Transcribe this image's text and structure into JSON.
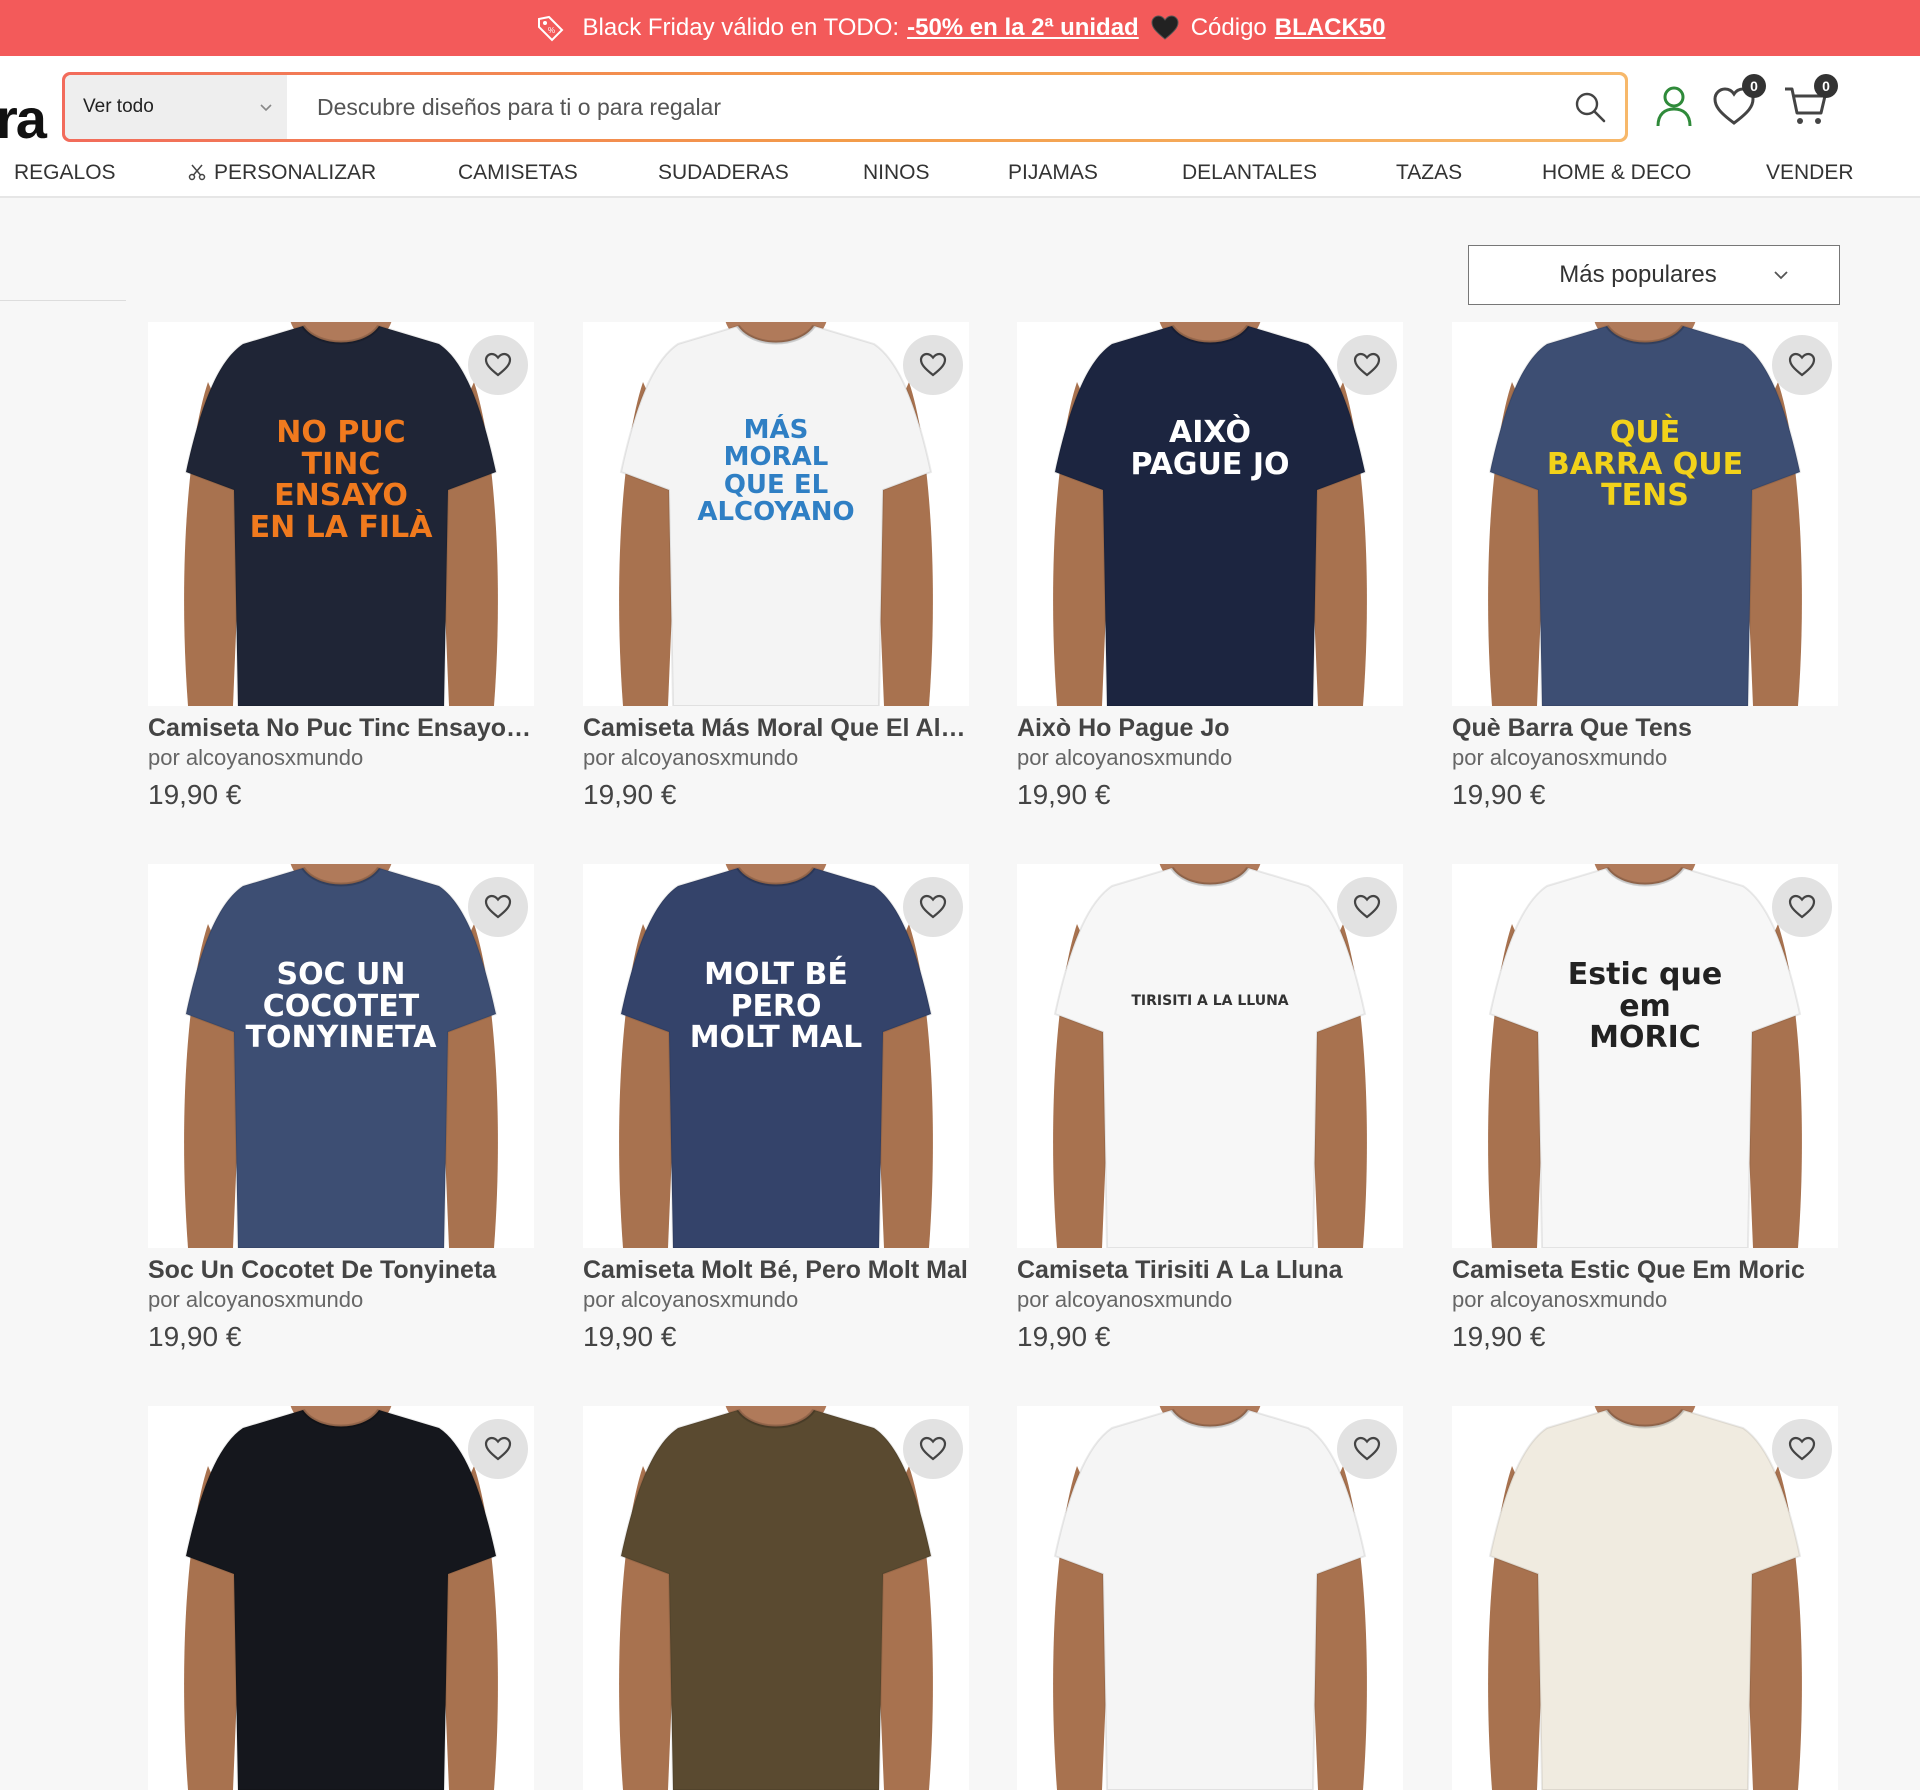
{
  "promo": {
    "text_before": "Black Friday válido en TODO:",
    "discount": "-50% en la 2ª unidad",
    "code_label": "Código",
    "code": "BLACK50"
  },
  "header": {
    "logo_fragment": "ra",
    "category_select": "Ver todo",
    "search_placeholder": "Descubre diseños para ti o para regalar",
    "wishlist_count": "0",
    "cart_count": "0"
  },
  "nav": [
    "REGALOS",
    "PERSONALIZAR",
    "CAMISETAS",
    "SUDADERAS",
    "NINOS",
    "PIJAMAS",
    "DELANTALES",
    "TAZAS",
    "HOME & DECO",
    "VENDER"
  ],
  "sort": {
    "selected": "Más populares"
  },
  "products": [
    {
      "title": "Camiseta No Puc Tinc Ensayo E...",
      "seller": "por alcoyanosxmundo",
      "price": "19,90 €",
      "shirt_color": "#1f2536",
      "design": [
        "NO PUC",
        "TINC ENSAYO",
        "EN LA FILÀ"
      ],
      "design_color": "#f07a1e"
    },
    {
      "title": "Camiseta Más Moral Que El Alc...",
      "seller": "por alcoyanosxmundo",
      "price": "19,90 €",
      "shirt_color": "#f4f4f4",
      "design": [
        "MÁS",
        "MORAL",
        "QUE EL",
        "ALCOYANO"
      ],
      "design_color": "#2f7fc4"
    },
    {
      "title": "Això Ho Pague Jo",
      "seller": "por alcoyanosxmundo",
      "price": "19,90 €",
      "shirt_color": "#1c2540",
      "design": [
        "AIXÒ",
        "PAGUE JO"
      ],
      "design_color": "#ffffff"
    },
    {
      "title": "Què Barra Que Tens",
      "seller": "por alcoyanosxmundo",
      "price": "19,90 €",
      "shirt_color": "#3d4e73",
      "design": [
        "QUÈ",
        "BARRA QUE",
        "TENS"
      ],
      "design_color": "#f2d21a"
    },
    {
      "title": "Soc Un Cocotet De Tonyineta",
      "seller": "por alcoyanosxmundo",
      "price": "19,90 €",
      "shirt_color": "#3d4e73",
      "design": [
        "SOC UN",
        "COCOTET",
        "TONYINETA"
      ],
      "design_color": "#ffffff"
    },
    {
      "title": "Camiseta Molt Bé, Pero Molt Mal",
      "seller": "por alcoyanosxmundo",
      "price": "19,90 €",
      "shirt_color": "#34436a",
      "design": [
        "MOLT BÉ",
        "PERO",
        "MOLT MAL"
      ],
      "design_color": "#ffffff"
    },
    {
      "title": "Camiseta Tirisiti A La Lluna",
      "seller": "por alcoyanosxmundo",
      "price": "19,90 €",
      "shirt_color": "#f7f7f7",
      "design": [
        "TIRISITI A LA LLUNA"
      ],
      "design_color": "#333333"
    },
    {
      "title": "Camiseta Estic Que Em Moric",
      "seller": "por alcoyanosxmundo",
      "price": "19,90 €",
      "shirt_color": "#f7f7f7",
      "design": [
        "Estic que em",
        "MORIC"
      ],
      "design_color": "#222222"
    },
    {
      "shirt_color": "#15171d"
    },
    {
      "shirt_color": "#5a4a30"
    },
    {
      "shirt_color": "#f5f5f5"
    },
    {
      "shirt_color": "#f0ebe0"
    }
  ],
  "colors": {
    "promo_bg": "#f35a5a",
    "search_gradient_start": "#f26b5b",
    "search_gradient_end": "#f7b86a",
    "accent_user": "#2f8a3a"
  }
}
